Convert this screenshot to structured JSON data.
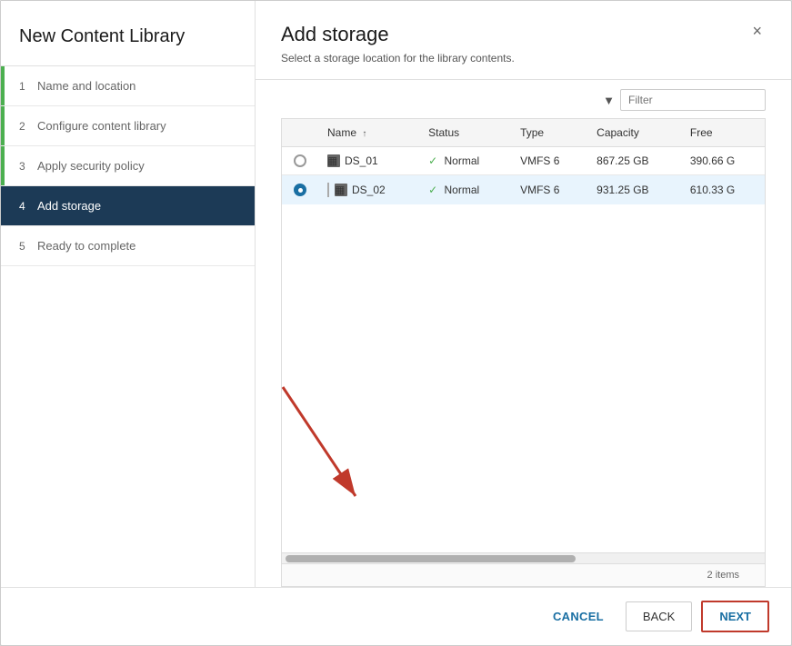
{
  "dialog": {
    "title": "New Content Library",
    "close_label": "×"
  },
  "sidebar": {
    "title": "New Content Library",
    "steps": [
      {
        "num": "1",
        "label": "Name and location",
        "state": "completed"
      },
      {
        "num": "2",
        "label": "Configure content library",
        "state": "completed"
      },
      {
        "num": "3",
        "label": "Apply security policy",
        "state": "completed"
      },
      {
        "num": "4",
        "label": "Add storage",
        "state": "active"
      },
      {
        "num": "5",
        "label": "Ready to complete",
        "state": "disabled"
      }
    ]
  },
  "main": {
    "title": "Add storage",
    "subtitle": "Select a storage location for the library contents.",
    "filter_placeholder": "Filter",
    "table": {
      "columns": [
        {
          "key": "select",
          "label": ""
        },
        {
          "key": "name",
          "label": "Name",
          "sortable": true
        },
        {
          "key": "status",
          "label": "Status"
        },
        {
          "key": "type",
          "label": "Type"
        },
        {
          "key": "capacity",
          "label": "Capacity"
        },
        {
          "key": "free",
          "label": "Free"
        }
      ],
      "rows": [
        {
          "id": "ds01",
          "selected": false,
          "name": "DS_01",
          "status": "Normal",
          "type": "VMFS 6",
          "capacity": "867.25 GB",
          "free": "390.66 G"
        },
        {
          "id": "ds02",
          "selected": true,
          "name": "DS_02",
          "status": "Normal",
          "type": "VMFS 6",
          "capacity": "931.25 GB",
          "free": "610.33 G"
        }
      ],
      "item_count": "2 items"
    }
  },
  "footer": {
    "cancel_label": "CANCEL",
    "back_label": "BACK",
    "next_label": "NEXT"
  },
  "icons": {
    "filter": "▼",
    "close": "✕",
    "check": "✓",
    "sort_up": "↑",
    "datastore": "▦"
  }
}
